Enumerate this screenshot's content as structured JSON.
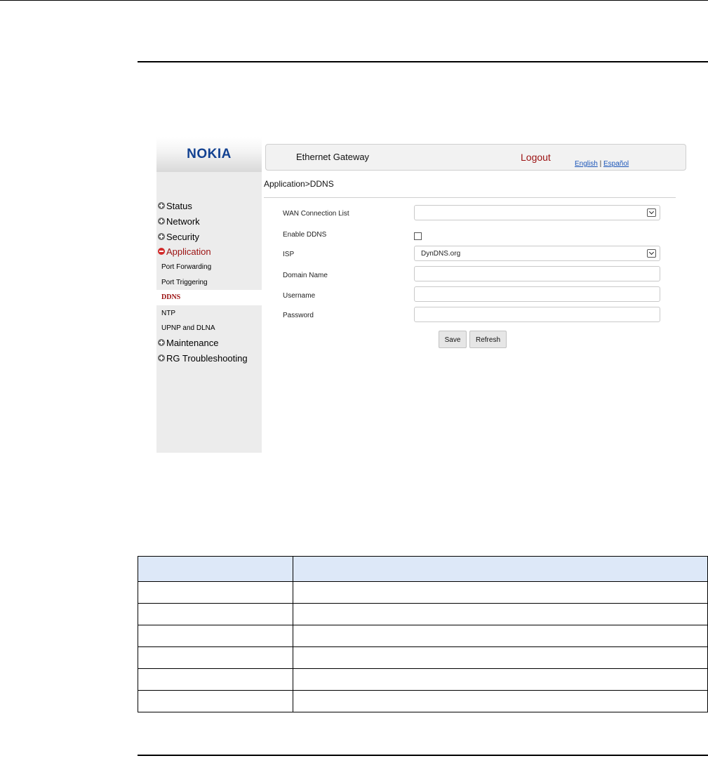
{
  "app": {
    "brand": "NOKIA",
    "title": "Ethernet Gateway",
    "logout": "Logout",
    "lang_english": "English",
    "lang_separator": "|",
    "lang_espanol": "Español"
  },
  "breadcrumb": "Application>DDNS",
  "sidebar": {
    "items": [
      {
        "label": "Status",
        "state": "collapsed"
      },
      {
        "label": "Network",
        "state": "collapsed"
      },
      {
        "label": "Security",
        "state": "collapsed"
      },
      {
        "label": "Application",
        "state": "expanded"
      },
      {
        "label": "Maintenance",
        "state": "collapsed"
      },
      {
        "label": "RG Troubleshooting",
        "state": "collapsed"
      }
    ],
    "sub_items": [
      "Port Forwarding",
      "Port Triggering",
      "DDNS",
      "NTP",
      "UPNP and DLNA"
    ],
    "current_sub_item": "DDNS"
  },
  "form": {
    "wan_label": "WAN Connection List",
    "wan_value": "",
    "enable_label": "Enable DDNS",
    "enable_checked": false,
    "isp_label": "ISP",
    "isp_value": "DynDNS.org",
    "domain_label": "Domain Name",
    "domain_value": "",
    "username_label": "Username",
    "username_value": "",
    "password_label": "Password",
    "password_value": "",
    "save": "Save",
    "refresh": "Refresh"
  },
  "table": {
    "headers": [
      "",
      ""
    ],
    "rows": [
      [
        "",
        ""
      ],
      [
        "",
        ""
      ],
      [
        "",
        ""
      ],
      [
        "",
        ""
      ],
      [
        "",
        ""
      ],
      [
        "",
        ""
      ]
    ]
  },
  "colors": {
    "brand_blue": "#124191",
    "accent_red": "#9b1010",
    "link_blue": "#1a55b8",
    "table_header": "#dde8f8"
  }
}
